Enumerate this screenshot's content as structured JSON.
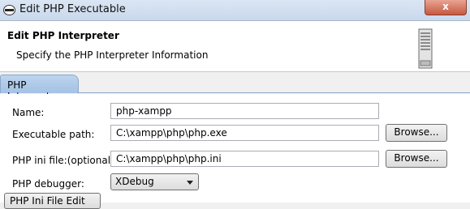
{
  "window": {
    "title": "Edit PHP Executable",
    "close_label": "x"
  },
  "banner": {
    "title": "Edit PHP Interpreter",
    "description": "Specify the PHP Interpreter Information"
  },
  "tabs": [
    {
      "label": "PHP Interpreter"
    }
  ],
  "form": {
    "name": {
      "label": "Name:",
      "value": "php-xampp"
    },
    "executable": {
      "label": "Executable path:",
      "value": "C:\\xampp\\php\\php.exe",
      "button": "Browse..."
    },
    "ini": {
      "label": "PHP ini file:(optional):",
      "value": "C:\\xampp\\php\\php.ini",
      "button": "Browse..."
    },
    "debugger": {
      "label": "PHP debugger:",
      "value": "XDebug"
    },
    "bottom_button": "PHP Ini File Edit"
  },
  "icons": {
    "app": "php-icon",
    "banner": "server-icon",
    "dropdown": "chevron-down-icon"
  },
  "colors": {
    "tab_fill": "#a4c2e4",
    "close_button": "#c7583f"
  }
}
